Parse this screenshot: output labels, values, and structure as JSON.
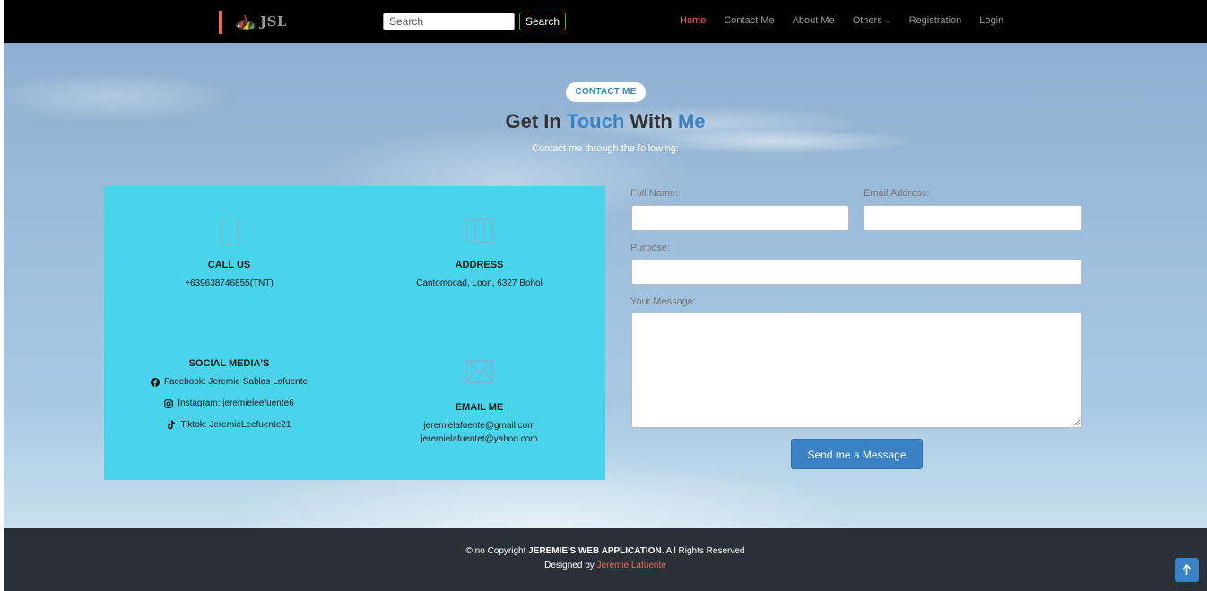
{
  "header": {
    "brand": "JSL",
    "search_placeholder": "Search",
    "search_button": "Search",
    "nav": [
      "Home",
      "Contact Me",
      "About Me",
      "Others",
      "Registration",
      "Login"
    ],
    "others_chevron": "⌵"
  },
  "hero": {
    "pill": "CONTACT ME",
    "title_parts": [
      "Get In ",
      "Touch",
      " With ",
      "Me"
    ],
    "subtitle": "Contact me through the following:"
  },
  "info": {
    "call": {
      "title": "CALL US",
      "value": "+639638746855(TNT)"
    },
    "address": {
      "title": "ADDRESS",
      "value": "Cantomocad, Loon, 6327 Bohol"
    },
    "social": {
      "title": "SOCIAL MEDIA'S",
      "facebook": "Facebook: Jeremie Sablas Lafuente",
      "instagram": "Instagram: jeremieleefuente6",
      "tiktok": "Tiktok: JeremieLeefuente21"
    },
    "email": {
      "title": "EMAIL ME",
      "lines": [
        "jeremielafuente@gmail.com",
        "jeremielafuentet@yahoo.com"
      ]
    }
  },
  "form": {
    "full_name_label": "Full Name:",
    "email_label": "Email Address:",
    "purpose_label": "Purpose:",
    "message_label": "Your Message:",
    "submit": "Send me a Message"
  },
  "footer": {
    "copy_prefix": "© no Copyright ",
    "copy_brand": "JEREMIE'S WEB APPLICATION",
    "copy_suffix": ". All Rights Reserved",
    "designed_by": "Designed by ",
    "designer": "Jeremie Lafuente"
  },
  "colors": {
    "accent": "#3b82c4",
    "brand_red": "#e96b56",
    "info_bg": "#4ad4ec",
    "footer_bg": "#2b2f38"
  }
}
